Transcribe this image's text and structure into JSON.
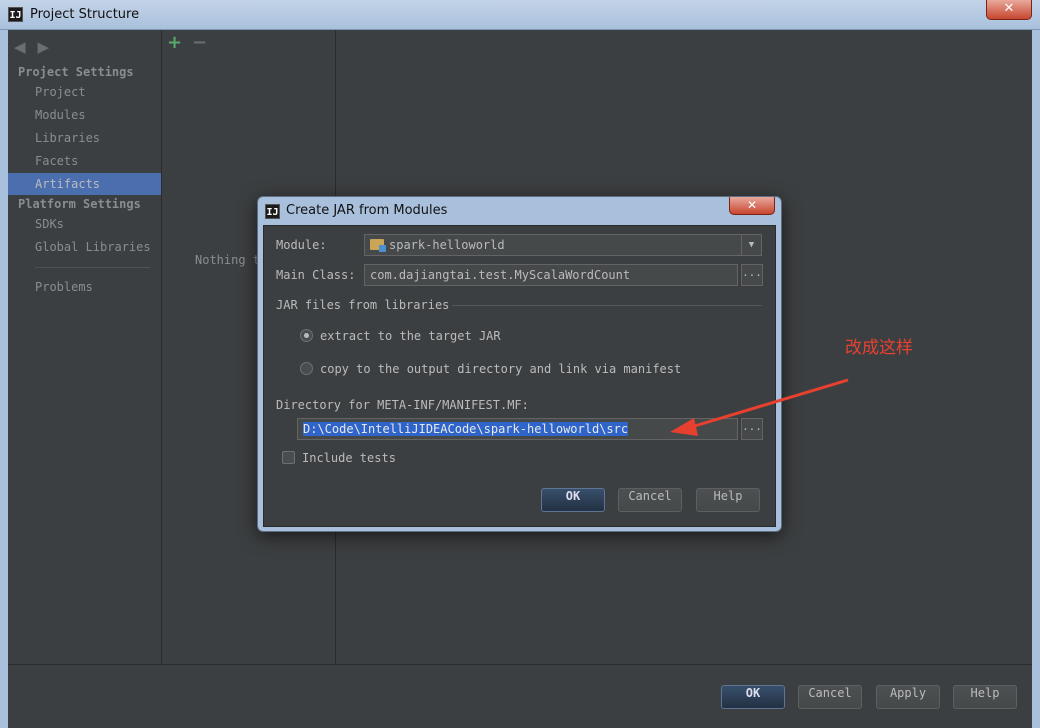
{
  "window": {
    "title": "Project Structure",
    "close_label": "✕",
    "app_icon_label": "IJ"
  },
  "nav": {
    "back_icon": "◀",
    "forward_icon": "▶",
    "project_settings_heading": "Project Settings",
    "project_items": [
      "Project",
      "Modules",
      "Libraries",
      "Facets",
      "Artifacts"
    ],
    "platform_settings_heading": "Platform Settings",
    "platform_items": [
      "SDKs",
      "Global Libraries"
    ],
    "problems": "Problems",
    "selected": "Artifacts"
  },
  "middle": {
    "add_icon": "+",
    "remove_icon": "−",
    "empty_text": "Nothing t"
  },
  "bottom_buttons": {
    "ok": "OK",
    "cancel": "Cancel",
    "apply": "Apply",
    "help": "Help"
  },
  "dialog": {
    "title": "Create JAR from Modules",
    "close_label": "✕",
    "app_icon_label": "IJ",
    "module_label": "Module:",
    "module_value": "spark-helloworld",
    "main_class_label": "Main Class:",
    "main_class_value": "com.dajiangtai.test.MyScalaWordCount",
    "browse_label": "...",
    "jar_group_label": "JAR files from libraries",
    "option_extract": "extract to the target JAR",
    "option_copy": "copy to the output directory and link via manifest",
    "selected_option": "extract",
    "manifest_dir_label": "Directory for META-INF/MANIFEST.MF:",
    "manifest_dir_value": "D:\\Code\\IntelliJIDEACode\\spark-helloworld\\src",
    "include_tests_label": "Include tests",
    "include_tests_checked": false,
    "ok": "OK",
    "cancel": "Cancel",
    "help": "Help"
  },
  "annotation": {
    "text": "改成这样",
    "color": "#e8402f"
  },
  "colors": {
    "background": "#3c3f41",
    "selection": "#4b6eaf",
    "accent_red": "#e8402f"
  }
}
